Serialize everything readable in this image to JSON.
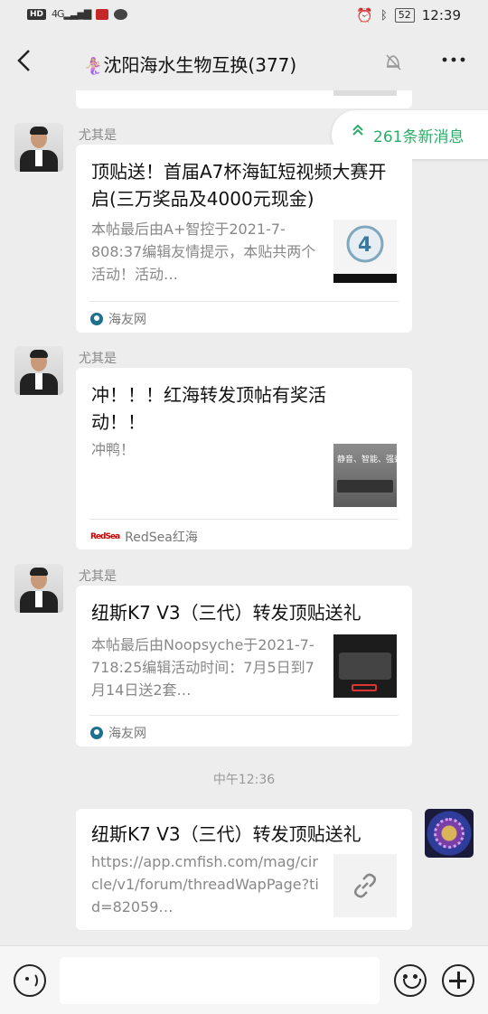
{
  "status_bar": {
    "hd_label": "HD",
    "network_label": "4G",
    "time": "12:39",
    "battery": "52",
    "icons": [
      "huawei-icon",
      "message-bubble-icon",
      "alarm-icon",
      "bluetooth-icon",
      "battery-icon"
    ]
  },
  "header": {
    "title": "沈阳海水生物互换(377)",
    "title_emoji": "🧜🏼‍♀️",
    "back_icon": "chevron-left-icon",
    "mute_icon": "bell-off-icon",
    "more_icon": "more-dots-icon"
  },
  "new_messages": {
    "label": "261条新消息",
    "icon": "double-chevron-up-icon"
  },
  "messages": [
    {
      "sender": "尤其是",
      "title": "顶贴送！首届A7杯海缸短视频大赛开启(三万奖品及4000元现金)",
      "desc": "本帖最后由A+智控于2021-7-808:37编辑友情提示，本贴共两个活动！活动…",
      "source": "海友网"
    },
    {
      "sender": "尤其是",
      "title": "冲！！！红海转发顶帖有奖活动！！",
      "desc": "冲鸭！",
      "source": "RedSea红海",
      "source_logo": "RedSea"
    },
    {
      "sender": "尤其是",
      "title": "纽斯K7 V3（三代）转发顶贴送礼",
      "desc": "本帖最后由Noopsyche于2021-7-718:25编辑活动时间：7月5日到7月14日送2套…",
      "source": "海友网"
    }
  ],
  "timestamp": "中午12:36",
  "self_message": {
    "title": "纽斯K7 V3（三代）转发顶贴送礼",
    "url": "https://app.cmfish.com/mag/circle/v1/forum/threadWapPage?tid=82059…",
    "icon": "link-icon"
  },
  "thumb_texts": {
    "redsea_caption": "静音、智能、强劲"
  },
  "input_bar": {
    "voice_icon": "voice-icon",
    "emoji_icon": "emoji-icon",
    "plus_icon": "plus-icon"
  },
  "colors": {
    "background": "#ededed",
    "accent_green": "#2aae67",
    "card": "#ffffff"
  }
}
